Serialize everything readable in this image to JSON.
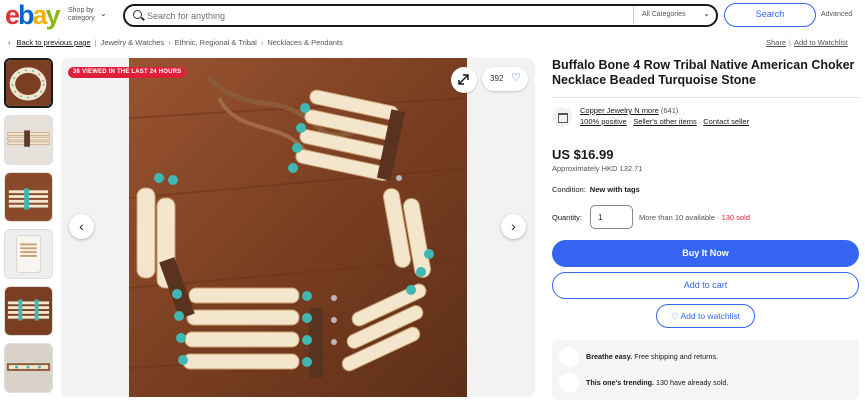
{
  "header": {
    "logo": {
      "e": "e",
      "b": "b",
      "a": "a",
      "y": "y"
    },
    "shop_by_line1": "Shop by",
    "shop_by_line2": "category",
    "search_placeholder": "Search for anything",
    "category": "All Categories",
    "search_button": "Search",
    "advanced": "Advanced"
  },
  "breadcrumb": {
    "back": "Back to previous page",
    "items": [
      "Jewelry & Watches",
      "Ethnic, Regional & Tribal",
      "Necklaces & Pendants"
    ],
    "share": "Share",
    "add_to_watchlist": "Add to Watchlist"
  },
  "gallery": {
    "viewed_badge": "36 VIEWED IN THE LAST 24 HOURS",
    "watch_count": "392",
    "thumbnail_count": 6
  },
  "listing": {
    "title": "Buffalo Bone 4 Row Tribal Native American Choker Necklace Beaded Turquoise Stone",
    "seller_name": "Copper Jewelry N more",
    "seller_feedback_count": "(641)",
    "seller_positive": "100% positive",
    "seller_other_items": "Seller's other items",
    "contact_seller": "Contact seller",
    "price": "US $16.99",
    "approx_price": "Approximately HKD 132.71",
    "condition_label": "Condition:",
    "condition_value": "New with tags",
    "quantity_label": "Quantity:",
    "quantity_value": "1",
    "available": "More than 10 available",
    "sold": "130 sold",
    "buy_now": "Buy It Now",
    "add_to_cart": "Add to cart",
    "add_to_watchlist": "Add to watchlist"
  },
  "promos": [
    {
      "bold": "Breathe easy.",
      "text": " Free shipping and returns."
    },
    {
      "bold": "This one's trending.",
      "text": " 130 have already sold."
    }
  ],
  "colors": {
    "accent": "#3665f3",
    "badge": "#e0203a",
    "wood": "#7a3f22",
    "bone": "#f3e6cc",
    "turquoise": "#3fb8b4"
  }
}
